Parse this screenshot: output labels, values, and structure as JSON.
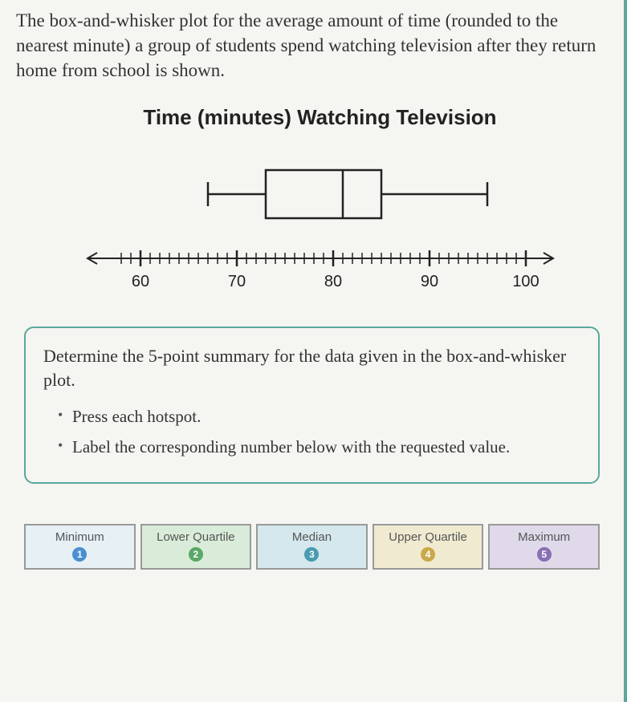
{
  "problem_text": "The box-and-whisker plot for the average amount of time (rounded to the nearest minute) a group of students spend watching television after they return home from school is shown.",
  "chart_data": {
    "type": "boxplot",
    "title": "Time (minutes) Watching Television",
    "xlabel": "",
    "axis_ticks": [
      60,
      70,
      80,
      90,
      100
    ],
    "axis_range": [
      57,
      103
    ],
    "minor_tick_interval": 1,
    "min": 67,
    "q1": 73,
    "median": 81,
    "q3": 85,
    "max": 96
  },
  "instructions": {
    "title": "Determine the 5-point summary for the data given in the box-and-whisker plot.",
    "items": [
      "Press each hotspot.",
      "Label the corresponding number below with the requested value."
    ]
  },
  "answers": [
    {
      "label": "Minimum",
      "num": "1"
    },
    {
      "label": "Lower Quartile",
      "num": "2"
    },
    {
      "label": "Median",
      "num": "3"
    },
    {
      "label": "Upper Quartile",
      "num": "4"
    },
    {
      "label": "Maximum",
      "num": "5"
    }
  ]
}
